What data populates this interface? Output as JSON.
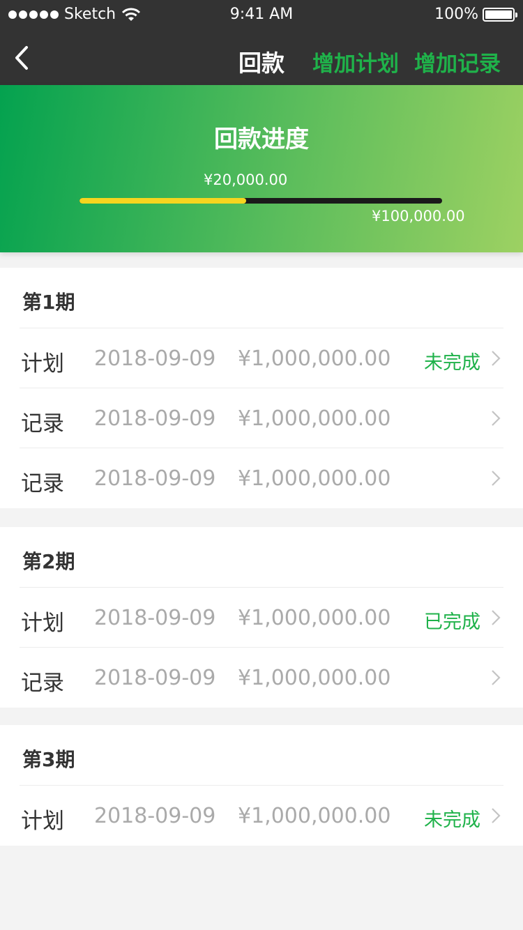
{
  "status_bar": {
    "carrier": "Sketch",
    "time": "9:41 AM",
    "battery": "100%"
  },
  "nav": {
    "title": "回款",
    "add_plan": "增加计划",
    "add_record": "增加记录"
  },
  "hero": {
    "title": "回款进度",
    "current_amount": "¥20,000.00",
    "total_amount": "¥100,000.00",
    "progress_fraction": 0.46
  },
  "periods": [
    {
      "title": "第1期",
      "rows": [
        {
          "type": "计划",
          "date": "2018-09-09",
          "amount": "¥1,000,000.00",
          "status": "未完成"
        },
        {
          "type": "记录",
          "date": "2018-09-09",
          "amount": "¥1,000,000.00",
          "status": ""
        },
        {
          "type": "记录",
          "date": "2018-09-09",
          "amount": "¥1,000,000.00",
          "status": ""
        }
      ]
    },
    {
      "title": "第2期",
      "rows": [
        {
          "type": "计划",
          "date": "2018-09-09",
          "amount": "¥1,000,000.00",
          "status": "已完成"
        },
        {
          "type": "记录",
          "date": "2018-09-09",
          "amount": "¥1,000,000.00",
          "status": ""
        }
      ]
    },
    {
      "title": "第3期",
      "rows": [
        {
          "type": "计划",
          "date": "2018-09-09",
          "amount": "¥1,000,000.00",
          "status": "未完成"
        }
      ]
    }
  ],
  "colors": {
    "accent_green": "#1fb24a",
    "progress_fill": "#f6d51f",
    "nav_background": "#333333"
  }
}
